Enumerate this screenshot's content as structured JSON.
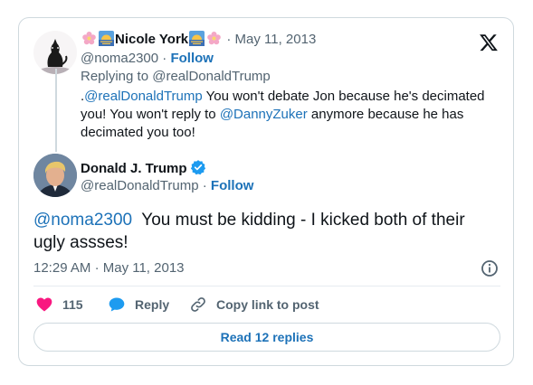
{
  "quoted_tweet": {
    "display_name": "Nicole York",
    "handle": "@noma2300",
    "date": "May 11, 2013",
    "separator": "·",
    "follow_label": "Follow",
    "replying_prefix": "Replying to",
    "replying_to": "@realDonaldTrump",
    "body": {
      "lead": ".",
      "mention1": "@realDonaldTrump",
      "middle": " You won't debate Jon because he's decimated you! You won't reply to ",
      "mention2": "@DannyZuker",
      "end": " anymore because he has decimated you too!"
    }
  },
  "main_tweet": {
    "display_name": "Donald J. Trump",
    "handle": "@realDonaldTrump",
    "separator": "·",
    "follow_label": "Follow",
    "verified": true,
    "body_mention": "@noma2300",
    "body_text": "  You must be kidding - I kicked both of their ugly assses!",
    "time": "12:29 AM",
    "date": "May 11, 2013"
  },
  "actions": {
    "like_count": "115",
    "reply_label": "Reply",
    "copy_label": "Copy link to post"
  },
  "read_replies_label": "Read 12 replies",
  "colors": {
    "link_blue": "#1d72b8",
    "like_pink": "#f91880",
    "verified_blue": "#1d9bf0",
    "muted": "#536471"
  }
}
